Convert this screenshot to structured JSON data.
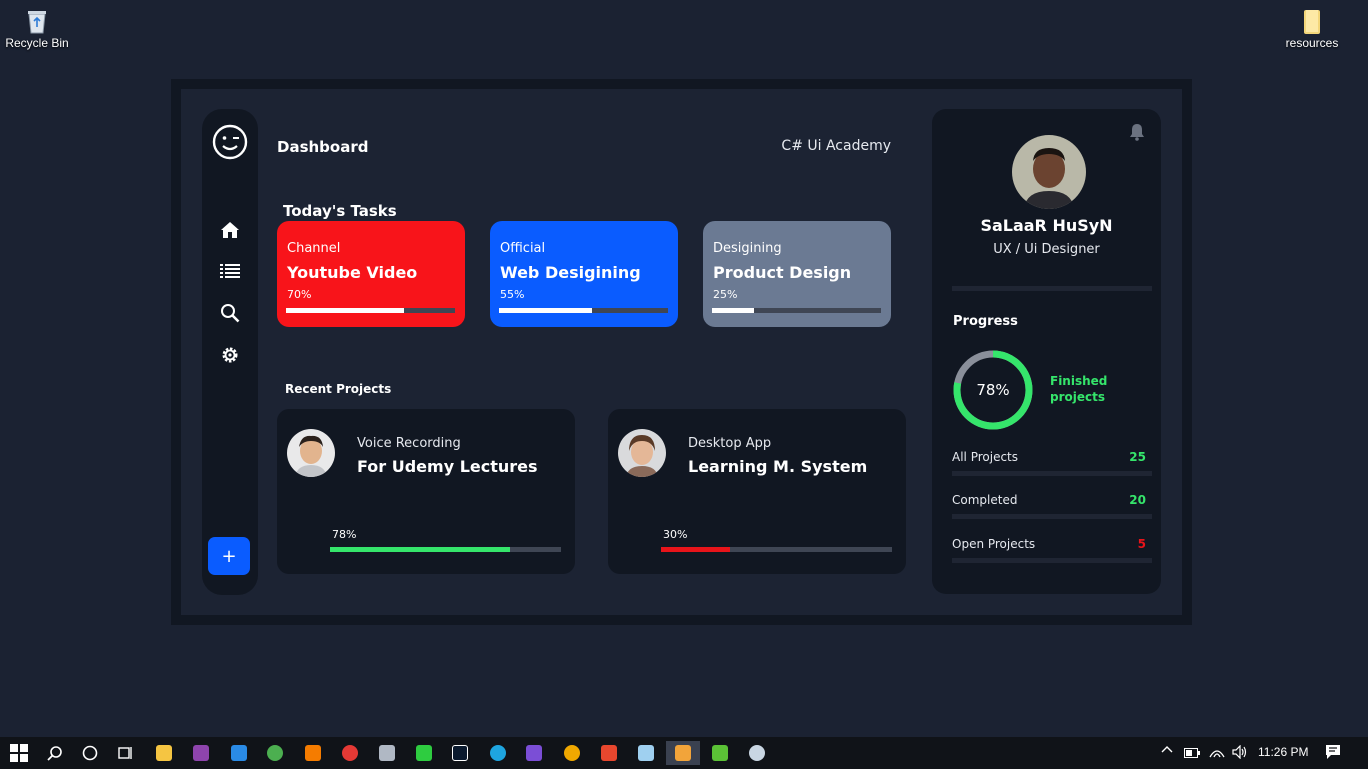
{
  "desktop": {
    "recycle_bin": "Recycle Bin",
    "resources": "resources"
  },
  "app": {
    "title": "Dashboard",
    "brand": "C# Ui Academy",
    "add_label": "+",
    "nav_icons": [
      "smile-icon",
      "home-icon",
      "list-icon",
      "search-icon",
      "settings-icon"
    ]
  },
  "tasks": {
    "heading": "Today's Tasks",
    "items": [
      {
        "category": "Channel",
        "name": "Youtube Video",
        "percent_label": "70%",
        "progress": 0.7,
        "color": "#f8141a"
      },
      {
        "category": "Official",
        "name": "Web Desigining",
        "percent_label": "55%",
        "progress": 0.55,
        "color": "#0a5cff"
      },
      {
        "category": "Desigining",
        "name": "Product Design",
        "percent_label": "25%",
        "progress": 0.25,
        "color": "#6b7a93"
      }
    ]
  },
  "projects": {
    "heading": "Recent Projects",
    "items": [
      {
        "category": "Voice Recording",
        "name": "For Udemy Lectures",
        "percent_label": "78%",
        "progress": 0.78,
        "bar_color": "#35e56b"
      },
      {
        "category": "Desktop App",
        "name": "Learning M. System",
        "percent_label": "30%",
        "progress": 0.3,
        "bar_color": "#e8141a"
      }
    ]
  },
  "profile": {
    "name": "SaLaaR HuSyN",
    "role": "UX / Ui Designer",
    "progress_title": "Progress",
    "ring_label": "78%",
    "ring_value": 0.78,
    "finished_label": "Finished projects",
    "stats": [
      {
        "label": "All Projects",
        "value": "25",
        "color": "#35e56b"
      },
      {
        "label": "Completed",
        "value": "20",
        "color": "#35e56b"
      },
      {
        "label": "Open Projects",
        "value": "5",
        "color": "#e8141a"
      }
    ]
  },
  "taskbar": {
    "time": "11:26 PM"
  }
}
